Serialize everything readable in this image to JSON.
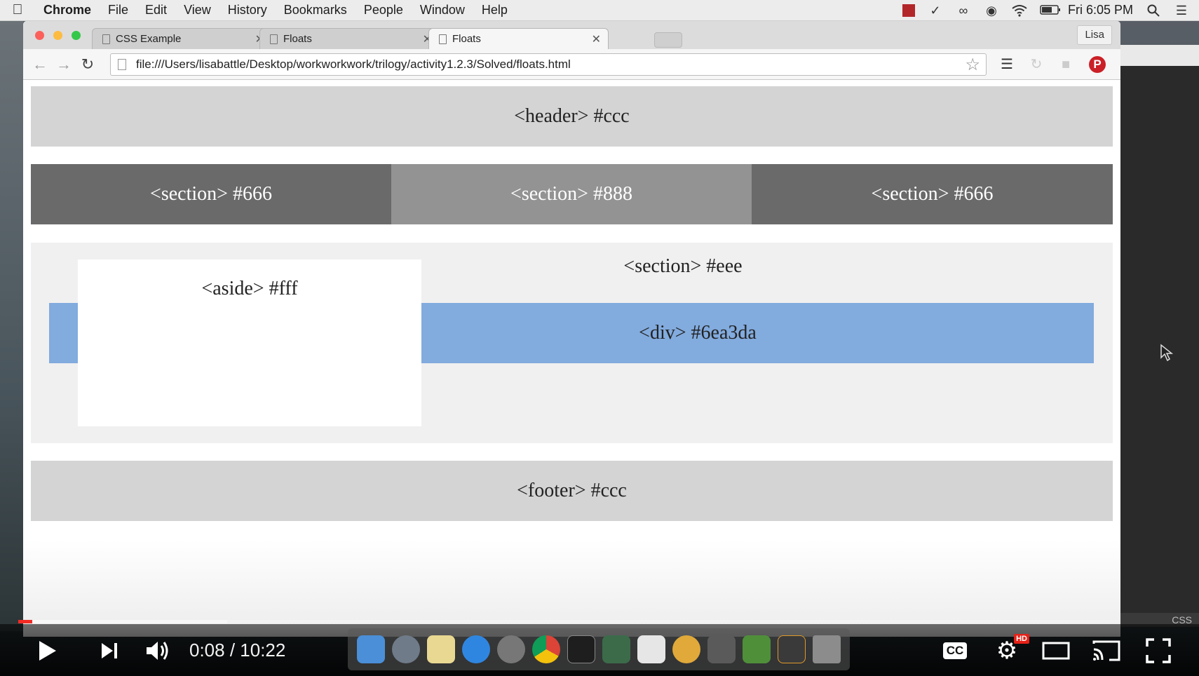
{
  "menubar": {
    "app": "Chrome",
    "items": [
      "File",
      "Edit",
      "View",
      "History",
      "Bookmarks",
      "People",
      "Window",
      "Help"
    ],
    "clock": "Fri 6:05 PM"
  },
  "browser": {
    "tabs": [
      {
        "title": "CSS Example"
      },
      {
        "title": "Floats"
      },
      {
        "title": "Floats"
      }
    ],
    "profile": "Lisa",
    "url": "file:///Users/lisabattle/Desktop/workworkwork/trilogy/activity1.2.3/Solved/floats.html"
  },
  "page": {
    "header": "<header> #ccc",
    "sections": [
      "<section> #666",
      "<section> #888",
      "<section> #666"
    ],
    "section_eee": "<section> #eee",
    "div": "<div> #6ea3da",
    "aside": "<aside> #fff",
    "footer": "<footer> #ccc"
  },
  "editor": {
    "status": "CSS"
  },
  "player": {
    "time": "0:08 / 10:22",
    "progress_fraction": 0.013,
    "buffered_fraction": 0.19,
    "hd_badge": "HD",
    "cc": "CC"
  },
  "colors": {
    "header": "#cccccc",
    "section_dark": "#666666",
    "section_mid": "#888888",
    "section_eee": "#eeeeee",
    "div": "#6ea3da",
    "aside": "#ffffff",
    "progress_red": "#f12b24"
  }
}
